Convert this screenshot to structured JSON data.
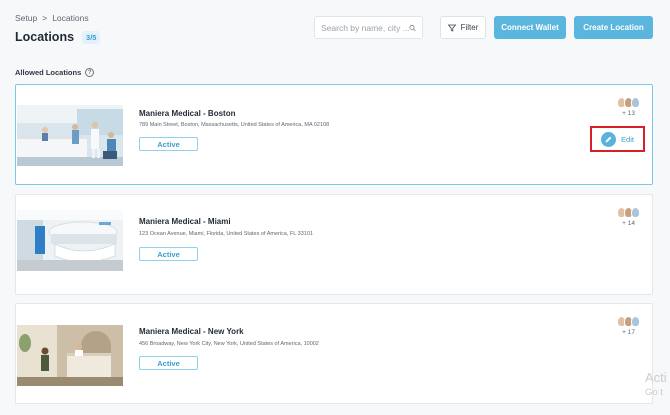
{
  "breadcrumb": {
    "root": "Setup",
    "separator": ">",
    "current": "Locations"
  },
  "header": {
    "title": "Locations",
    "count": "3/5"
  },
  "search": {
    "placeholder": "Search by name, city ..."
  },
  "toolbar": {
    "filter_label": "Filter",
    "connect_wallet_label": "Connect Wallet",
    "create_location_label": "Create Location"
  },
  "section": {
    "label": "Allowed Locations",
    "help": "?"
  },
  "locations": [
    {
      "name": "Maniera Medical - Boston",
      "address": "789 Main Street, Boston, Massachusetts, United States of America, MA 02108",
      "status": "Active",
      "extra_members": "+ 13",
      "edit_label": "Edit"
    },
    {
      "name": "Maniera Medical - Miami",
      "address": "123 Ocean Avenue, Miami, Florida, United States of America, FL 33101",
      "status": "Active",
      "extra_members": "+ 14"
    },
    {
      "name": "Maniera Medical - New York",
      "address": "456 Broadway, New York City, New York, United States of America, 10002",
      "status": "Active",
      "extra_members": "+ 17"
    }
  ],
  "watermark": {
    "line1": "Acti",
    "line2": "Go t"
  },
  "colors": {
    "accent": "#5ab6dd",
    "highlight_border": "#d61f26",
    "selected_border": "#7cc8e8"
  }
}
